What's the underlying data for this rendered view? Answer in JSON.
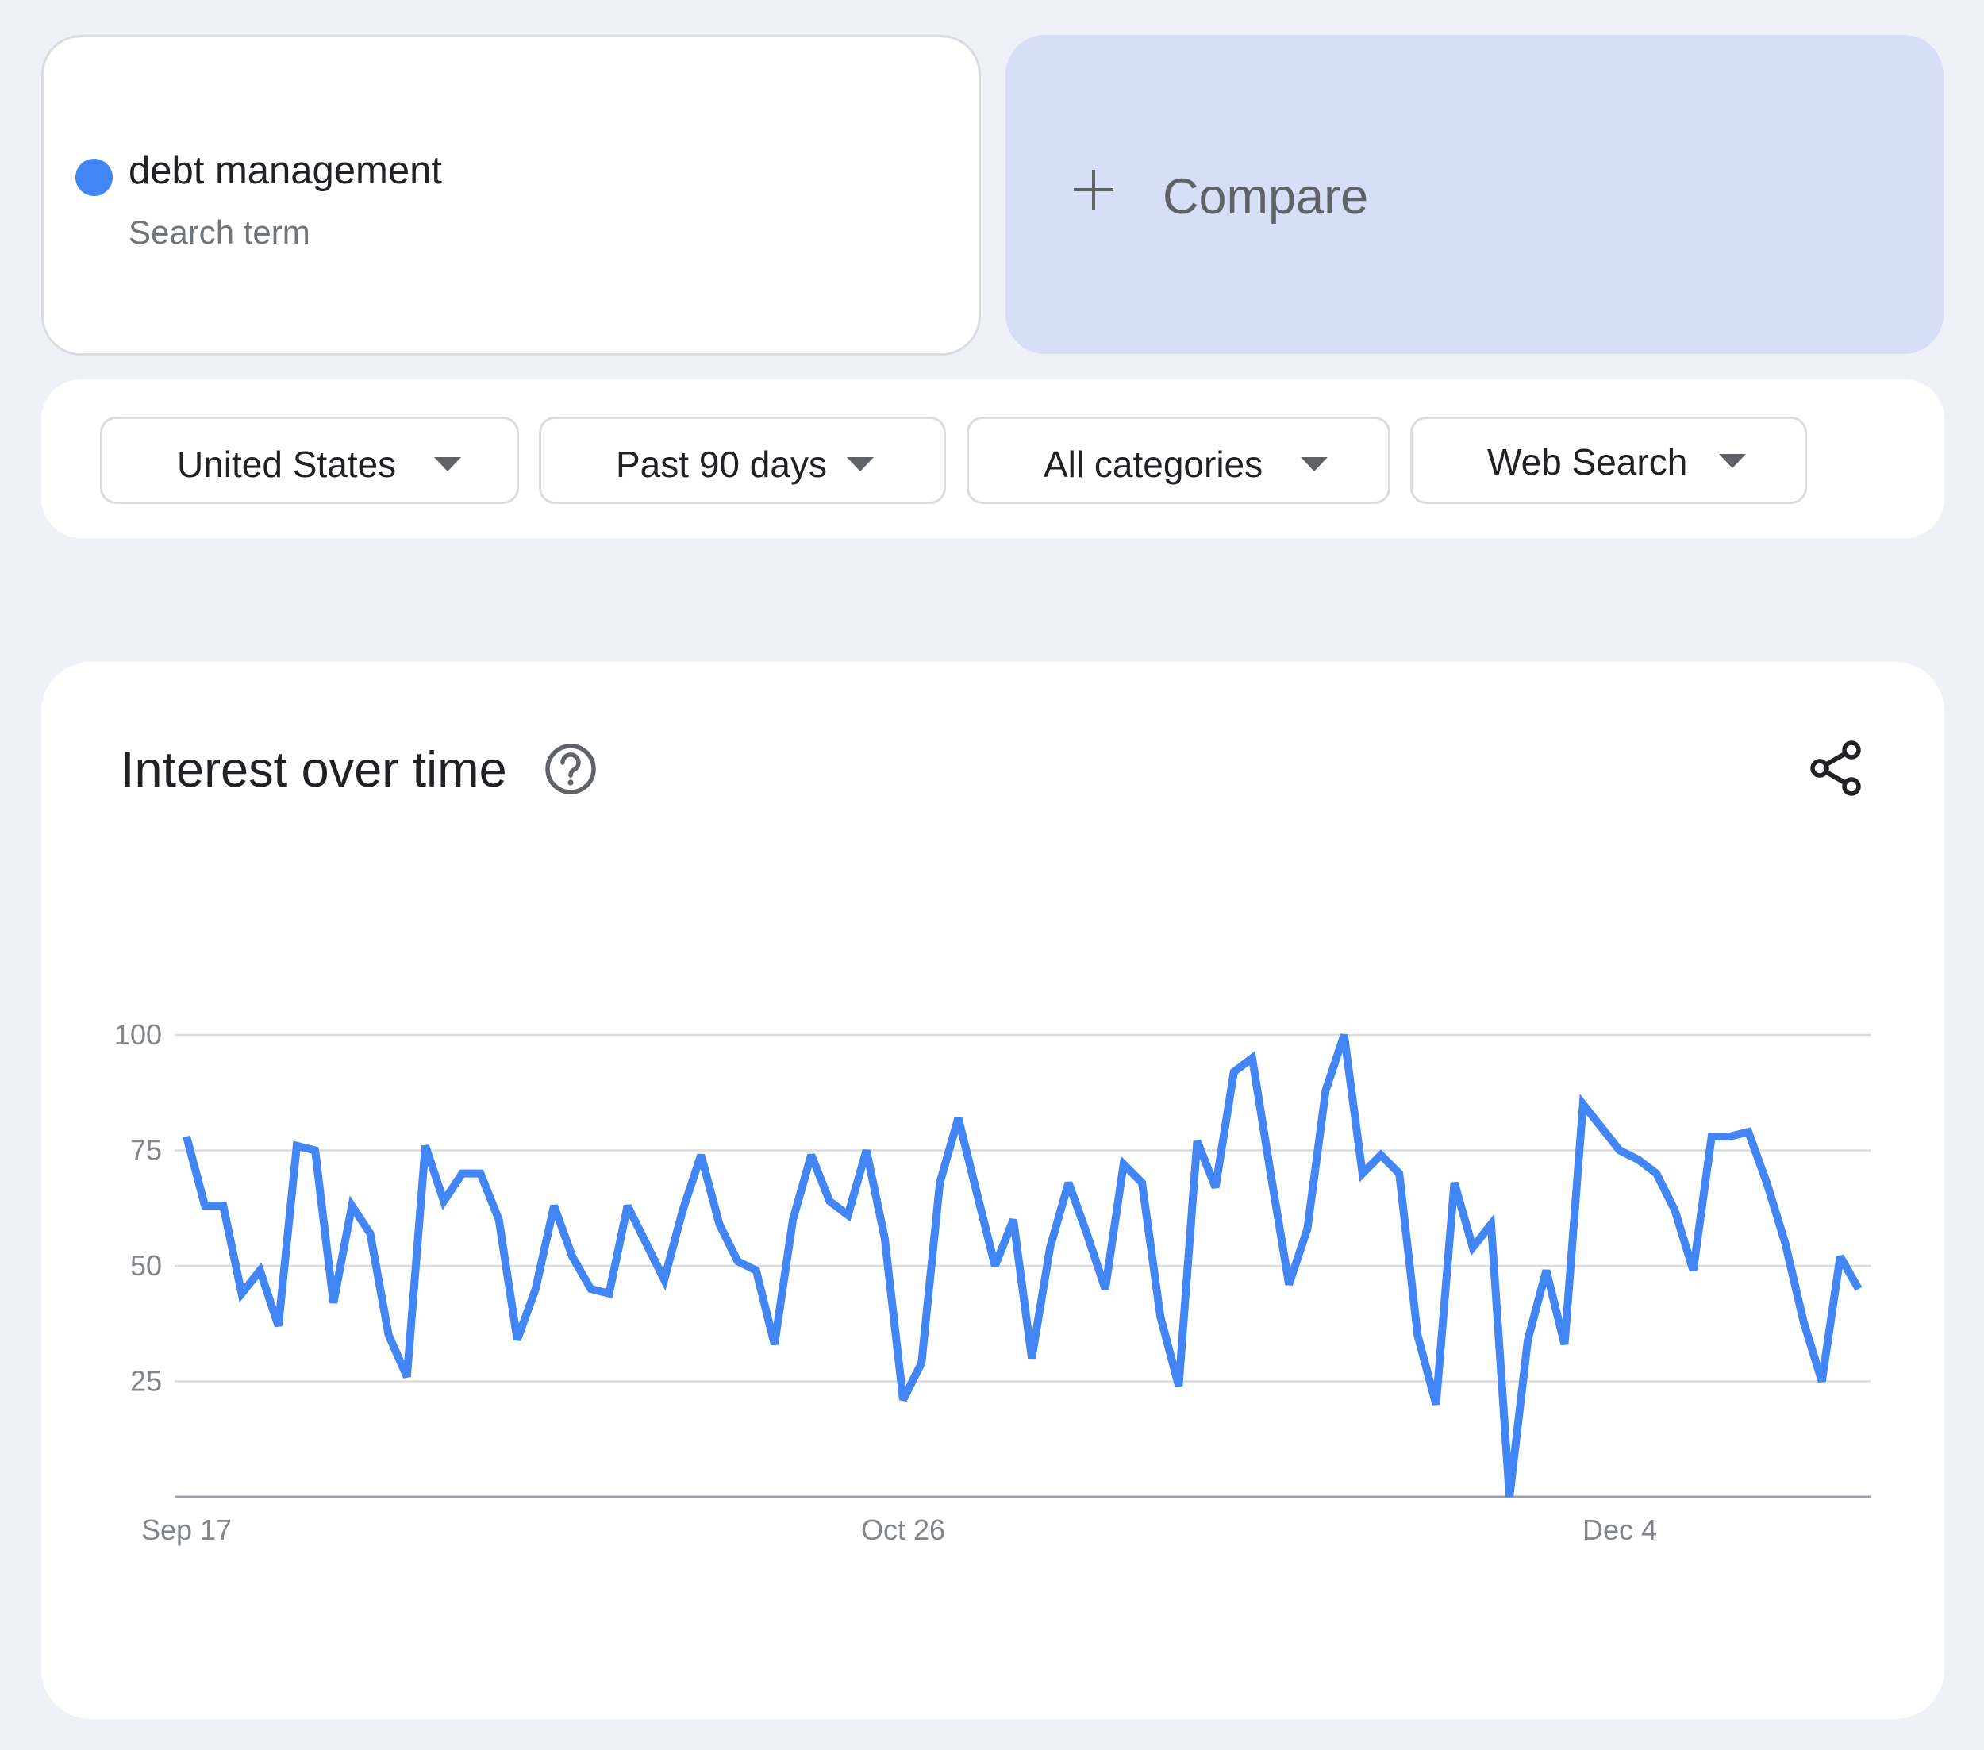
{
  "term": {
    "name": "debt management",
    "subtitle": "Search term",
    "color": "#4285f4"
  },
  "compare": {
    "label": "Compare",
    "icon": "plus-icon",
    "background": "#d6dff5"
  },
  "filters": [
    {
      "label": "United States",
      "icon": "caret-down-icon"
    },
    {
      "label": "Past 90 days",
      "icon": "caret-down-icon"
    },
    {
      "label": "All categories",
      "icon": "caret-down-icon"
    },
    {
      "label": "Web Search",
      "icon": "caret-down-icon"
    }
  ],
  "panel": {
    "title": "Interest over time",
    "help_icon": "help-circle-icon",
    "share_icon": "share-icon"
  },
  "chart_data": {
    "type": "line",
    "y_ticks": [
      25,
      50,
      75,
      100
    ],
    "x_ticks": [
      "Sep 17",
      "Oct 26",
      "Dec 4"
    ],
    "ylim": [
      0,
      100
    ],
    "grid": true,
    "series": [
      {
        "color": "#4285f4",
        "values": [
          78,
          63,
          63,
          44,
          49,
          37,
          76,
          75,
          42,
          63,
          57,
          35,
          26,
          76,
          64,
          70,
          70,
          60,
          34,
          45,
          63,
          52,
          45,
          44,
          63,
          55,
          47,
          62,
          74,
          59,
          51,
          49,
          33,
          60,
          74,
          64,
          61,
          75,
          56,
          21,
          29,
          68,
          82,
          66,
          50,
          60,
          30,
          54,
          68,
          57,
          45,
          72,
          68,
          39,
          24,
          77,
          67,
          92,
          95,
          70,
          46,
          58,
          88,
          100,
          70,
          74,
          70,
          35,
          20,
          68,
          54,
          59,
          0,
          34,
          49,
          33,
          85,
          80,
          75,
          73,
          70,
          62,
          49,
          78,
          78,
          79,
          68,
          55,
          38,
          25,
          52,
          45
        ]
      }
    ]
  }
}
